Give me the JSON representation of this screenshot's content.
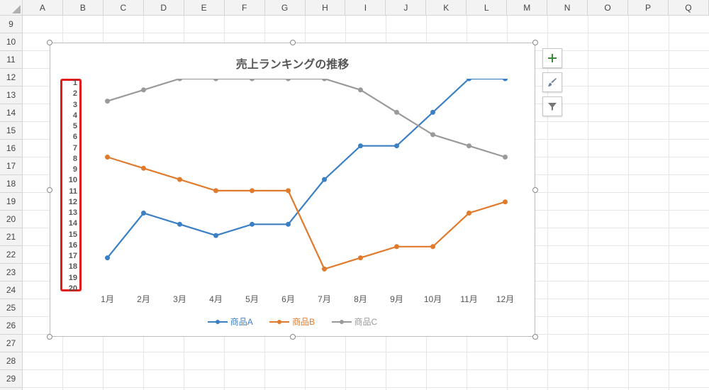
{
  "spreadsheet": {
    "columns": [
      "A",
      "B",
      "C",
      "D",
      "E",
      "F",
      "G",
      "H",
      "I",
      "J",
      "K",
      "L",
      "M",
      "N",
      "O",
      "P",
      "Q"
    ],
    "first_row": 9,
    "row_count": 21
  },
  "chart_data": {
    "type": "line",
    "title": "売上ランキングの推移",
    "xlabel": "",
    "ylabel": "",
    "categories": [
      "1月",
      "2月",
      "3月",
      "4月",
      "5月",
      "6月",
      "7月",
      "8月",
      "9月",
      "10月",
      "11月",
      "12月"
    ],
    "series": [
      {
        "name": "商品A",
        "color": "#3b7fc4",
        "values": [
          17,
          13,
          14,
          15,
          14,
          14,
          10,
          7,
          7,
          4,
          1,
          1
        ]
      },
      {
        "name": "商品B",
        "color": "#e07a2c",
        "values": [
          8,
          9,
          10,
          11,
          11,
          11,
          18,
          17,
          16,
          16,
          13,
          12
        ]
      },
      {
        "name": "商品C",
        "color": "#9a9a9a",
        "values": [
          3,
          2,
          1,
          1,
          1,
          1,
          1,
          2,
          4,
          6,
          7,
          8
        ]
      }
    ],
    "ylim": [
      1,
      20
    ],
    "y_reversed": false,
    "y_ticks": [
      1,
      2,
      3,
      4,
      5,
      6,
      7,
      8,
      9,
      10,
      11,
      12,
      13,
      14,
      15,
      16,
      17,
      18,
      19,
      20
    ],
    "grid": false,
    "legend_position": "bottom"
  },
  "legend": {
    "product_a": "商品A",
    "product_b": "商品B",
    "product_c": "商品C"
  },
  "side_buttons": {
    "add": "+",
    "brush": "brush",
    "filter": "filter"
  }
}
